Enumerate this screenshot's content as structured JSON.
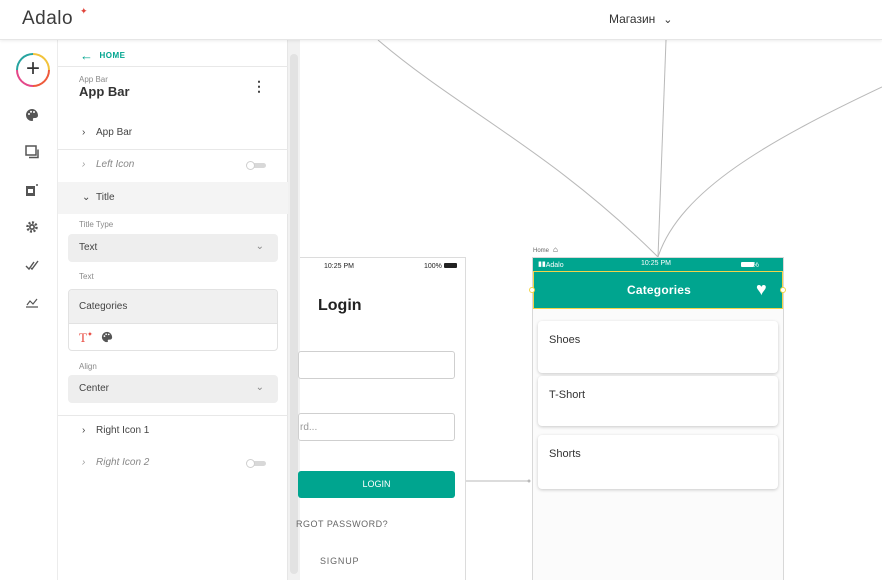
{
  "header": {
    "logo": "Adalo",
    "app_name": "Магазин",
    "chevron_icon": "chevron-down-icon"
  },
  "toolbar": {
    "icons": [
      "add-icon",
      "palette-icon",
      "screens-icon",
      "new-component-icon",
      "settings-icon",
      "publish-check-icon",
      "analytics-icon"
    ]
  },
  "panel": {
    "back_label": "HOME",
    "component_type": "App Bar",
    "component_name": "App Bar",
    "rows": {
      "app_bar": "App Bar",
      "left_icon": "Left Icon",
      "title": "Title",
      "right_icon_1": "Right Icon 1",
      "right_icon_2": "Right Icon 2"
    },
    "left_icon_enabled": false,
    "right_icon_2_enabled": false,
    "title_type_label": "Title Type",
    "title_type_value": "Text",
    "text_label": "Text",
    "text_value": "Categories",
    "align_label": "Align",
    "align_value": "Center"
  },
  "login_screen": {
    "time": "10:25 PM",
    "battery": "100%",
    "title": "Login",
    "password_placeholder": "rd...",
    "login_button": "LOGIN",
    "forgot_password": "RGOT PASSWORD?",
    "signup": "SIGNUP"
  },
  "categories_screen": {
    "screen_label": "Home",
    "carrier": "Adalo",
    "time": "10:25 PM",
    "battery": "100%",
    "title": "Categories",
    "items": [
      "Shoes",
      "T-Short",
      "Shorts"
    ]
  },
  "colors": {
    "accent": "#00a58f",
    "selection": "#f2d44a"
  }
}
